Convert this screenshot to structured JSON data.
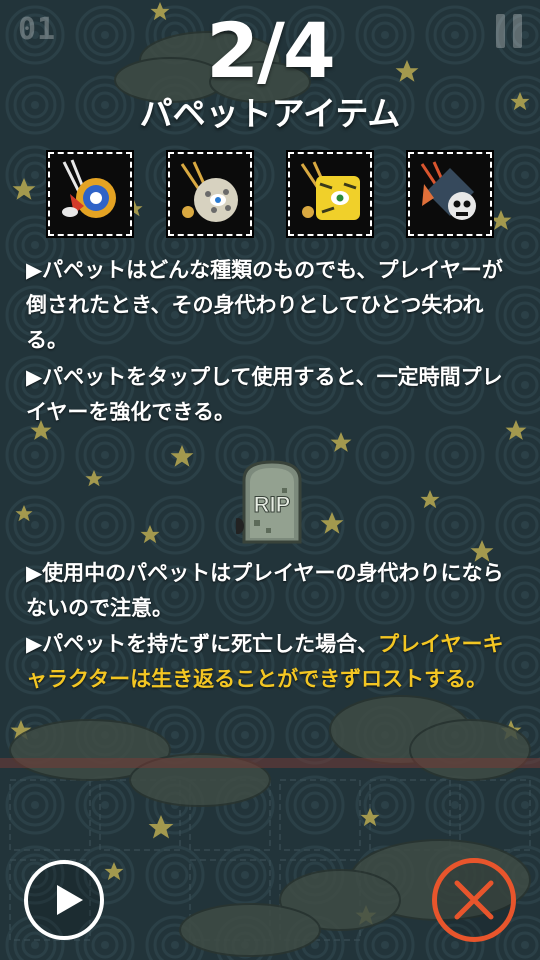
{
  "hud": {
    "counter": "01",
    "pause_icon": "pause-icon"
  },
  "page": {
    "indicator": "2/4",
    "title": "パペットアイテム"
  },
  "items": [
    {
      "icon": "puppet-blue-gear-icon"
    },
    {
      "icon": "puppet-gold-mask-icon"
    },
    {
      "icon": "puppet-yellow-tiger-icon"
    },
    {
      "icon": "puppet-skull-diamond-icon"
    }
  ],
  "paragraphs": {
    "p1": "▶パペットはどんな種類のものでも、プレイヤーが倒されたとき、その身代わりとしてひとつ失われる。",
    "p2": "▶パペットをタップして使用すると、一定時間プレイヤーを強化できる。",
    "p3": "▶使用中のパペットはプレイヤーの身代わりにならないので注意。",
    "p4_normal": "▶パペットを持たずに死亡した場合、",
    "p4_highlight": "プレイヤーキャラクターは生き返ることができずロストする。"
  },
  "tombstone": {
    "label": "RIP",
    "icon": "tombstone-icon"
  },
  "buttons": {
    "play_icon": "play-icon",
    "close_icon": "close-icon"
  },
  "colors": {
    "background": "#23343a",
    "highlight": "#f3c623",
    "close_accent": "#e8552c",
    "text": "#ffffff"
  }
}
